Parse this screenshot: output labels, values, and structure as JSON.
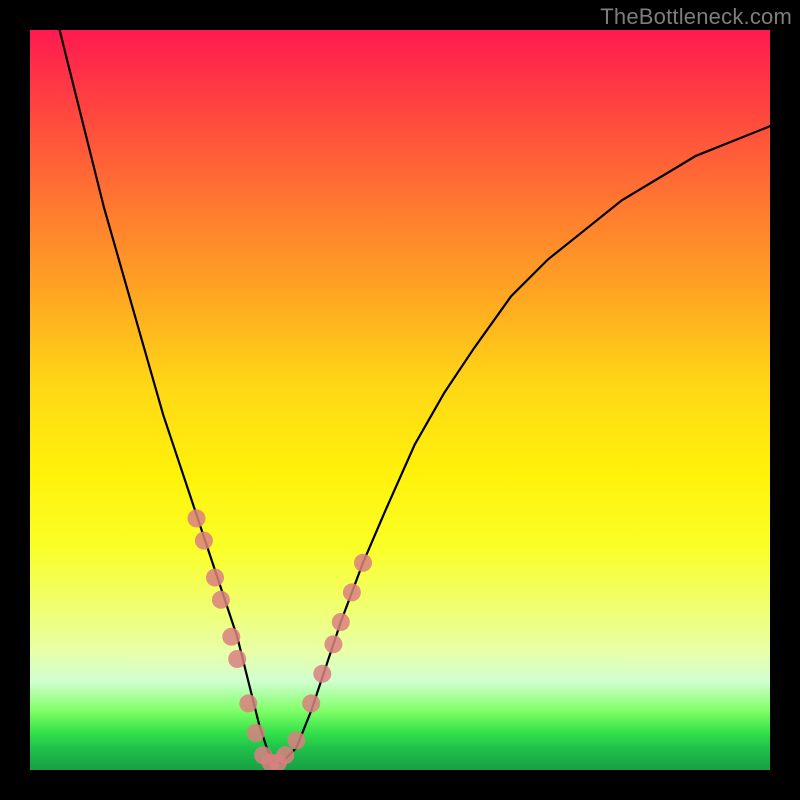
{
  "watermark": "TheBottleneck.com",
  "chart_data": {
    "type": "line",
    "title": "",
    "xlabel": "",
    "ylabel": "",
    "xlim": [
      0,
      100
    ],
    "ylim": [
      0,
      100
    ],
    "series": [
      {
        "name": "curve",
        "x": [
          4,
          6,
          8,
          10,
          12,
          14,
          16,
          18,
          20,
          22,
          24,
          26,
          28,
          30,
          31,
          32,
          33,
          34,
          36,
          38,
          40,
          42,
          45,
          48,
          52,
          56,
          60,
          65,
          70,
          75,
          80,
          85,
          90,
          95,
          100
        ],
        "y": [
          100,
          92,
          84,
          76,
          69,
          62,
          55,
          48,
          42,
          36,
          30,
          24,
          18,
          10,
          6,
          3,
          1,
          1,
          3,
          8,
          14,
          20,
          28,
          35,
          44,
          51,
          57,
          64,
          69,
          73,
          77,
          80,
          83,
          85,
          87
        ]
      }
    ],
    "markers": {
      "name": "highlight-points",
      "color": "#d98080",
      "x": [
        22.5,
        23.5,
        25.0,
        25.8,
        27.2,
        28.0,
        29.5,
        30.5,
        31.5,
        32.5,
        33.5,
        34.5,
        36.0,
        38.0,
        39.5,
        41.0,
        42.0,
        43.5,
        45.0
      ],
      "y": [
        34,
        31,
        26,
        23,
        18,
        15,
        9,
        5,
        2,
        1,
        1,
        2,
        4,
        9,
        13,
        17,
        20,
        24,
        28
      ]
    },
    "gradient_bands": [
      {
        "y": 100,
        "color": "#ff1a4f"
      },
      {
        "y": 60,
        "color": "#ffd716"
      },
      {
        "y": 20,
        "color": "#f0ff70"
      },
      {
        "y": 5,
        "color": "#33e04a"
      },
      {
        "y": 0,
        "color": "#17a044"
      }
    ]
  }
}
